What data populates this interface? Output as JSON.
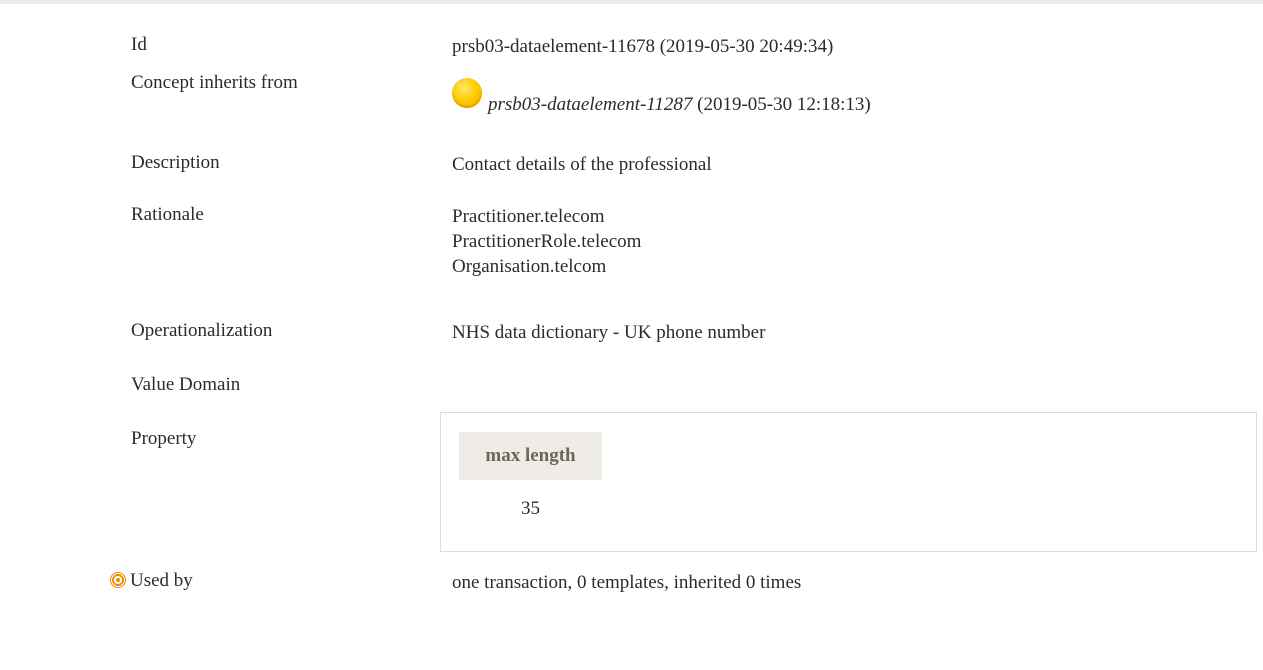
{
  "rows": {
    "id": {
      "label": "Id",
      "value": "prsb03-dataelement-11678 (2019-05-30 20:49:34)"
    },
    "inherits": {
      "label": "Concept inherits from",
      "link": "prsb03-dataelement-11287",
      "suffix": " (2019-05-30 12:18:13)",
      "icon": "yellow-status-dot"
    },
    "description": {
      "label": "Description",
      "value": "Contact details of the professional"
    },
    "rationale": {
      "label": "Rationale",
      "lines": [
        "Practitioner.telecom",
        "PractitionerRole.telecom",
        "Organisation.telcom"
      ]
    },
    "operationalization": {
      "label": "Operationalization",
      "value": "NHS data dictionary - UK phone number"
    },
    "value_domain": {
      "label": "Value Domain"
    },
    "property": {
      "label": "Property",
      "header": "max length",
      "value": "35"
    },
    "used_by": {
      "label": "Used by",
      "icon": "target-icon",
      "value": "one transaction, 0 templates, inherited 0 times"
    }
  },
  "colors": {
    "text": "#2b2b2b",
    "property_header_bg": "#efece8",
    "property_header_text": "#6e6459",
    "border": "#dcdcdc",
    "status_dot": "#ffcc00",
    "target_icon": "#f08a00"
  }
}
